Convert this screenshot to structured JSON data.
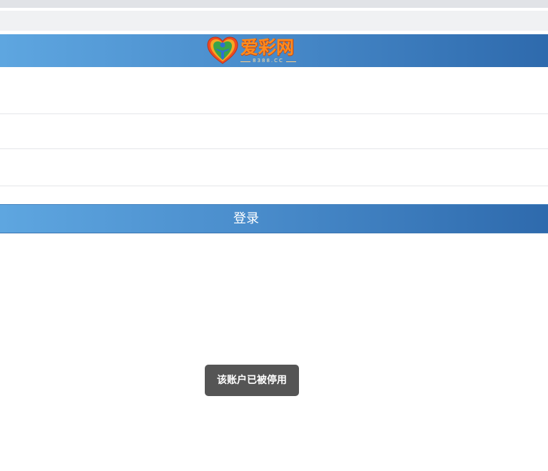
{
  "header": {
    "logo": {
      "title": "爱彩网",
      "subtitle": "8388.CC"
    }
  },
  "form": {
    "fields": [
      {
        "value": "",
        "placeholder": ""
      },
      {
        "value": "",
        "placeholder": ""
      },
      {
        "value": "",
        "placeholder": ""
      }
    ],
    "login_label": "登录"
  },
  "toast": {
    "message": "该账户已被停用"
  },
  "colors": {
    "header_gradient_start": "#5ea6e0",
    "header_gradient_end": "#2e6aad",
    "toast_bg": "#555555",
    "logo_orange": "#ff8a1c"
  }
}
